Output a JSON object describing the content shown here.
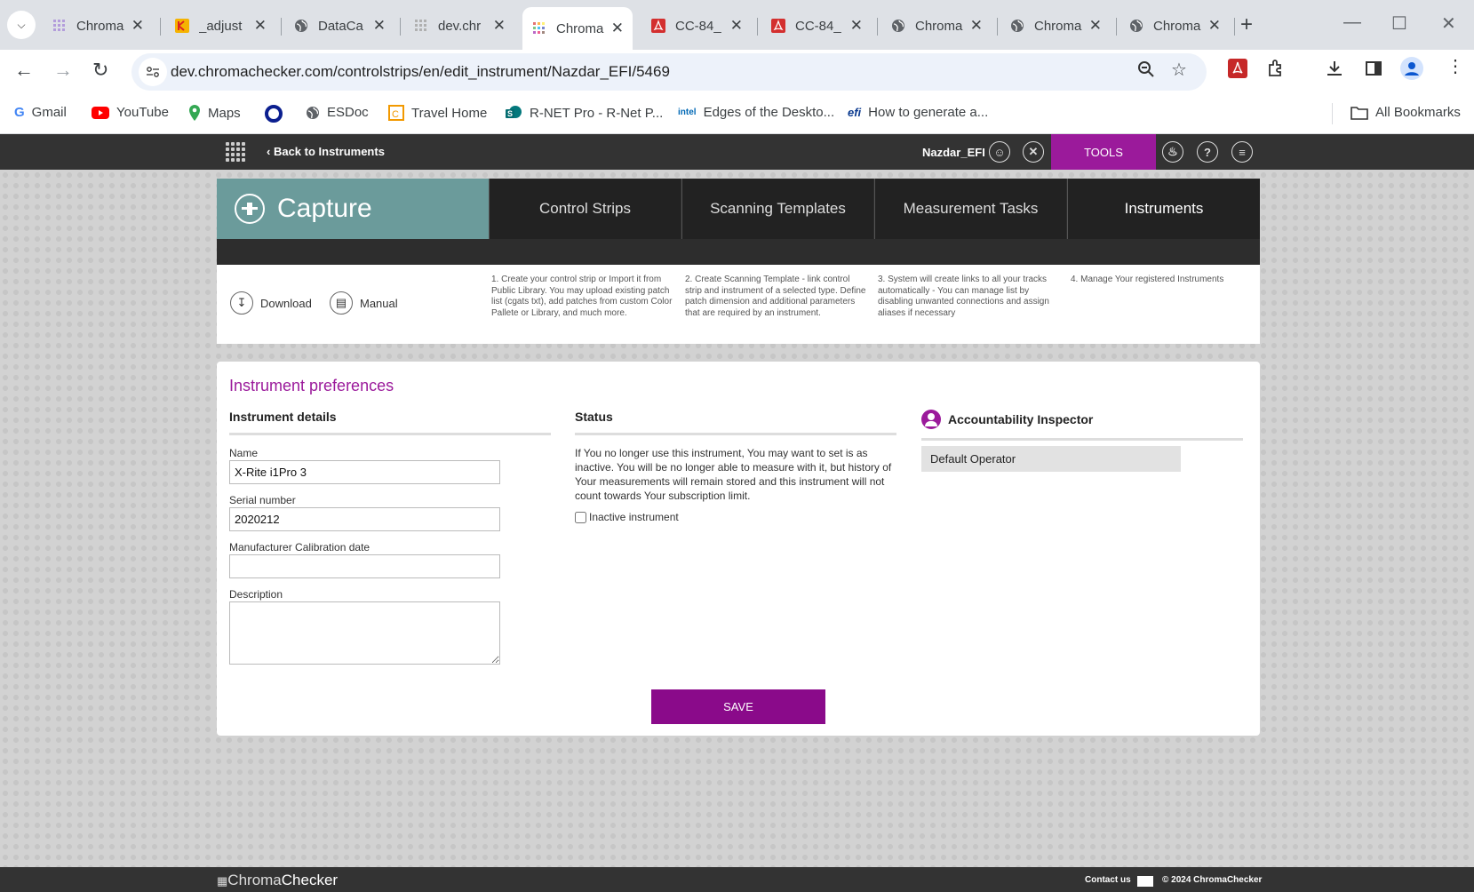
{
  "browser": {
    "tabs": [
      {
        "label": "Chroma",
        "icon": "chromachecker-icon"
      },
      {
        "label": "_adjust",
        "icon": "kodak-icon"
      },
      {
        "label": "DataCa",
        "icon": "globe-icon"
      },
      {
        "label": "dev.chr",
        "icon": "chromachecker-icon"
      },
      {
        "label": "Chroma",
        "icon": "chromachecker-icon",
        "active": true
      },
      {
        "label": "CC-84_",
        "icon": "pdf-icon"
      },
      {
        "label": "CC-84_",
        "icon": "pdf-icon"
      },
      {
        "label": "Chroma",
        "icon": "globe-icon"
      },
      {
        "label": "Chroma",
        "icon": "globe-icon"
      },
      {
        "label": "Chroma",
        "icon": "globe-icon"
      }
    ],
    "url": "dev.chromachecker.com/controlstrips/en/edit_instrument/Nazdar_EFI/5469",
    "bookmarks": [
      "Gmail",
      "YouTube",
      "Maps",
      "",
      "ESDoc",
      "Travel Home",
      "R-NET Pro - R-Net P...",
      "Edges of the Deskto...",
      "How to generate a..."
    ],
    "all_bookmarks": "All Bookmarks",
    "colors": {
      "tabstrip": "#dee1e6",
      "accent": "#9b1a9b"
    }
  },
  "appbar": {
    "back_label": "Back to Instruments",
    "username": "Nazdar_EFI",
    "tools_label": "TOOLS"
  },
  "capture": {
    "title": "Capture",
    "nav": [
      "Control Strips",
      "Scanning Templates",
      "Measurement Tasks",
      "Instruments"
    ],
    "download_label": "Download",
    "manual_label": "Manual",
    "steps": [
      "1. Create your control strip or Import it from Public Library. You may upload existing patch list (cgats txt), add patches from custom Color Pallete or Library, and much more.",
      "2. Create Scanning Template - link control strip and instrument of a selected type. Define patch dimension and additional parameters that are required by an instrument.",
      "3. System will create links to all your tracks automatically - You can manage list by disabling unwanted connections and assign aliases if necessary",
      "4. Manage Your registered Instruments"
    ]
  },
  "preferences": {
    "title": "Instrument preferences",
    "details_heading": "Instrument details",
    "name_label": "Name",
    "name_value": "X-Rite i1Pro 3",
    "serial_label": "Serial number",
    "serial_value": "2020212",
    "calib_label": "Manufacturer Calibration date",
    "calib_value": "",
    "desc_label": "Description",
    "status_heading": "Status",
    "status_text": "If You no longer use this instrument, You may want to set is as inactive. You will be no longer able to measure with it, but history of Your measurements will remain stored and this instrument will not count towards Your subscription limit.",
    "inactive_label": "Inactive instrument",
    "inspector_heading": "Accountability Inspector",
    "operator": "Default Operator",
    "save_label": "SAVE"
  },
  "footer": {
    "logo_a": "Chroma",
    "logo_b": "Checker",
    "contact": "Contact us",
    "copyright": "© 2024 ChromaChecker"
  }
}
